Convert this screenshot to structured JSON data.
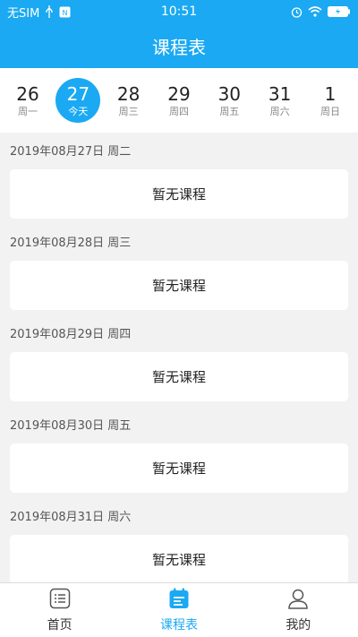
{
  "status_bar": {
    "carrier": "无SIM",
    "time": "10:51"
  },
  "title": "课程表",
  "week": [
    {
      "num": "26",
      "label": "周一",
      "active": false
    },
    {
      "num": "27",
      "label": "今天",
      "active": true
    },
    {
      "num": "28",
      "label": "周三",
      "active": false
    },
    {
      "num": "29",
      "label": "周四",
      "active": false
    },
    {
      "num": "30",
      "label": "周五",
      "active": false
    },
    {
      "num": "31",
      "label": "周六",
      "active": false
    },
    {
      "num": "1",
      "label": "周日",
      "active": false
    }
  ],
  "days": [
    {
      "date": "2019年08月27日 周二",
      "empty_text": "暂无课程"
    },
    {
      "date": "2019年08月28日 周三",
      "empty_text": "暂无课程"
    },
    {
      "date": "2019年08月29日 周四",
      "empty_text": "暂无课程"
    },
    {
      "date": "2019年08月30日 周五",
      "empty_text": "暂无课程"
    },
    {
      "date": "2019年08月31日 周六",
      "empty_text": "暂无课程"
    }
  ],
  "tabs": [
    {
      "label": "首页",
      "icon": "home-list-icon"
    },
    {
      "label": "课程表",
      "icon": "schedule-icon"
    },
    {
      "label": "我的",
      "icon": "profile-icon"
    }
  ],
  "colors": {
    "accent": "#1aa9f2"
  }
}
